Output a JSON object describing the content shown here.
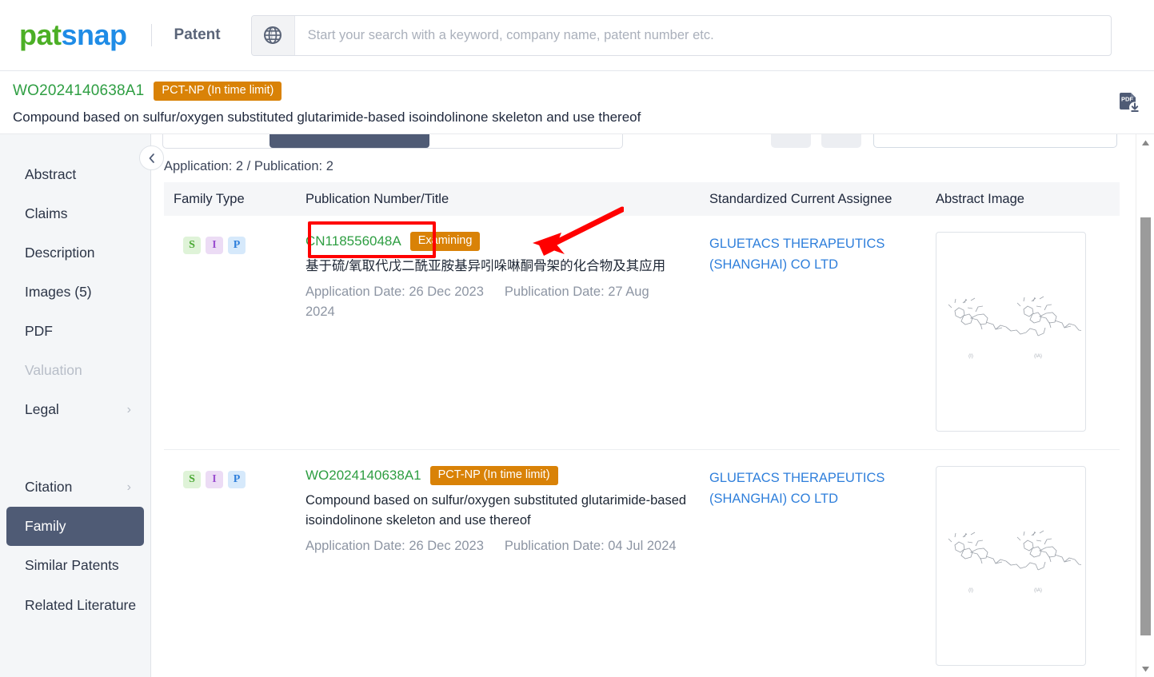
{
  "header": {
    "logo_pat": "pat",
    "logo_snap": "snap",
    "product": "Patent",
    "globe_icon": "globe-icon",
    "search_placeholder": "Start your search with a keyword, company name, patent number etc.",
    "search_value": ""
  },
  "patent": {
    "publication_number": "WO2024140638A1",
    "status_tag": "PCT-NP (In time limit)",
    "title": "Compound based on sulfur/oxygen substituted glutarimide-based isoindolinone skeleton and use thereof",
    "pdf_icon": "pdf-download-icon"
  },
  "sidebar": {
    "items": [
      {
        "label": "Abstract",
        "state": "normal",
        "chevron": false
      },
      {
        "label": "Claims",
        "state": "normal",
        "chevron": false
      },
      {
        "label": "Description",
        "state": "normal",
        "chevron": false
      },
      {
        "label": "Images (5)",
        "state": "normal",
        "chevron": false
      },
      {
        "label": "PDF",
        "state": "normal",
        "chevron": false
      },
      {
        "label": "Valuation",
        "state": "disabled",
        "chevron": false
      },
      {
        "label": "Legal",
        "state": "normal",
        "chevron": true
      }
    ],
    "items2": [
      {
        "label": "Citation",
        "state": "normal",
        "chevron": true
      },
      {
        "label": "Family",
        "state": "active",
        "chevron": false
      },
      {
        "label": "Similar Patents",
        "state": "normal",
        "chevron": false
      },
      {
        "label": "Related Literature",
        "state": "normal",
        "chevron": false
      }
    ],
    "collapse_icon": "chevron-left-icon"
  },
  "main": {
    "counts": "Application: 2 / Publication: 2",
    "columns": [
      "Family Type",
      "Publication Number/Title",
      "Standardized Current Assignee",
      "Abstract Image"
    ],
    "rows": [
      {
        "badges": [
          "S",
          "I",
          "P"
        ],
        "publication_number": "CN118556048A",
        "tag": "Examining",
        "tag_color": "#d98207",
        "title": "基于硫/氧取代戊二酰亚胺基异吲哚啉酮骨架的化合物及其应用",
        "application_date": "Application Date: 26 Dec 2023",
        "publication_date": "Publication Date: 27 Aug 2024",
        "assignee": "GLUETACS THERAPEUTICS (SHANGHAI) CO LTD",
        "abstract_image": "chemical-structure-thumbnail"
      },
      {
        "badges": [
          "S",
          "I",
          "P"
        ],
        "publication_number": "WO2024140638A1",
        "tag": "PCT-NP (In time limit)",
        "tag_color": "#d98207",
        "title": "Compound based on sulfur/oxygen substituted glutarimide-based isoindolinone skeleton and use thereof",
        "application_date": "Application Date: 26 Dec 2023",
        "publication_date": "Publication Date: 04 Jul 2024",
        "assignee": "GLUETACS THERAPEUTICS (SHANGHAI) CO LTD",
        "abstract_image": "chemical-structure-thumbnail"
      }
    ]
  },
  "annotation": {
    "highlight_color": "#ff0000",
    "highlight_target": "CN118556048A",
    "arrow": "red-arrow-pointing-left"
  },
  "colors": {
    "brand_green": "#4caf26",
    "brand_blue": "#1f8ce6",
    "accent_orange": "#d98207",
    "active_nav": "#4f5b75",
    "link_blue": "#2f7fdb",
    "pubnum_green": "#2e9e42"
  }
}
